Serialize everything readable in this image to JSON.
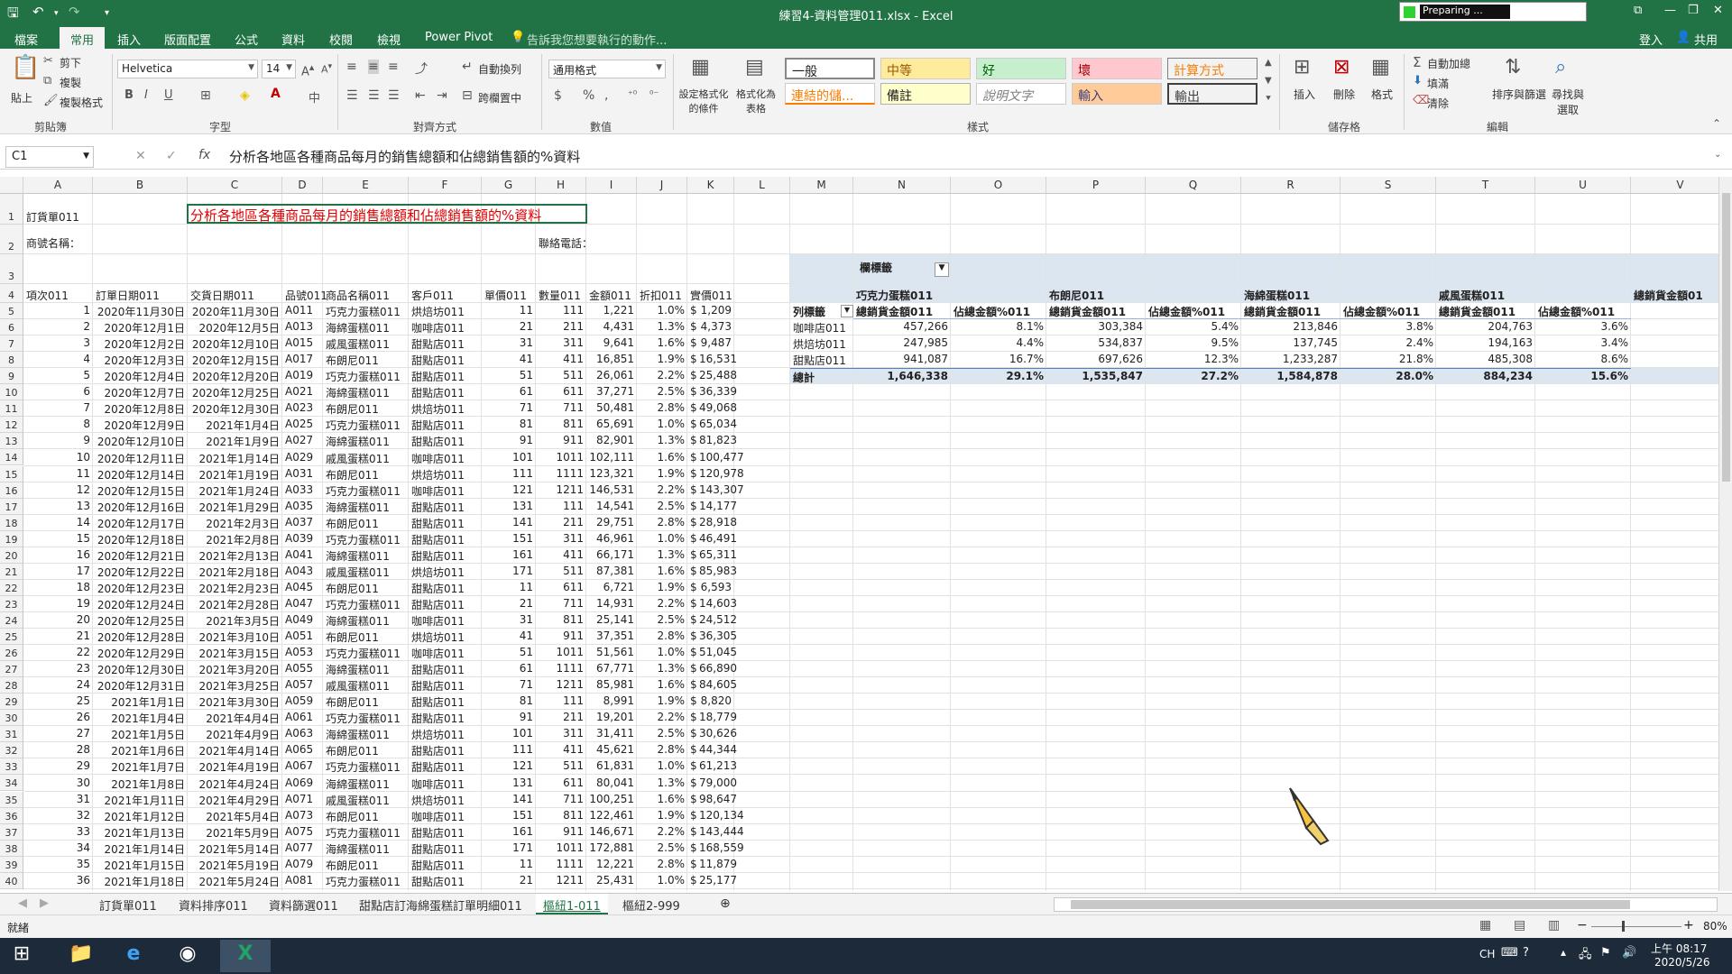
{
  "window": {
    "title": "練習4-資料管理011.xlsx - Excel",
    "preparing": "Preparing ..."
  },
  "ribbon_tabs": [
    "檔案",
    "常用",
    "插入",
    "版面配置",
    "公式",
    "資料",
    "校閱",
    "檢視",
    "Power Pivot"
  ],
  "tell_me": "告訴我您想要執行的動作...",
  "account": {
    "signin": "登入",
    "share": "共用"
  },
  "ribbon": {
    "paste": "貼上",
    "cut": "剪下",
    "copy": "複製",
    "format_painter": "複製格式",
    "clipboard_label": "剪貼簿",
    "font_name": "Helvetica",
    "font_size": "14",
    "font_label": "字型",
    "wrap_text": "自動換列",
    "merge_center": "跨欄置中",
    "align_label": "對齊方式",
    "number_format": "通用格式",
    "number_label": "數值",
    "cond_format": "設定格式化的條件",
    "format_table": "格式化為表格",
    "styles_label": "樣式",
    "styles": {
      "normal": "一般",
      "neutral": "中等",
      "good": "好",
      "bad": "壞",
      "calculation": "計算方式",
      "linked": "連結的儲...",
      "note": "備註",
      "explanatory": "說明文字",
      "input": "輸入",
      "output": "輸出"
    },
    "insert": "插入",
    "delete": "刪除",
    "format": "格式",
    "cells_label": "儲存格",
    "autosum": "自動加總",
    "fill": "填滿",
    "clear": "清除",
    "sort_filter": "排序與篩選",
    "find_select": "尋找與選取",
    "editing_label": "編輯"
  },
  "formula_bar": {
    "name_box": "C1",
    "formula": "分析各地區各種商品每月的銷售總額和佔總銷售額的%資料"
  },
  "columns": [
    "A",
    "B",
    "C",
    "D",
    "E",
    "F",
    "G",
    "H",
    "I",
    "J",
    "K",
    "L",
    "M",
    "N",
    "O",
    "P",
    "Q",
    "R",
    "S",
    "T",
    "U",
    "V"
  ],
  "sheet": {
    "a1": "訂貨單011",
    "c1": "分析各地區各種商品每月的銷售總額和佔總銷售額的%資料",
    "a2": "商號名稱：",
    "h2": "聯絡電話：",
    "headers": [
      "項次011",
      "訂單日期011",
      "交貨日期011",
      "品號011",
      "商品名稱011",
      "客戶011",
      "單價011",
      "數量011",
      "金額011",
      "折扣011",
      "實價011"
    ],
    "rows": [
      [
        "1",
        "2020年11月30日",
        "2020年11月30日",
        "A011",
        "巧克力蛋糕011",
        "烘焙坊011",
        "11",
        "111",
        "1,221",
        "1.0%",
        "$",
        "1,209"
      ],
      [
        "2",
        "2020年12月1日",
        "2020年12月5日",
        "A013",
        "海綿蛋糕011",
        "咖啡店011",
        "21",
        "211",
        "4,431",
        "1.3%",
        "$",
        "4,373"
      ],
      [
        "3",
        "2020年12月2日",
        "2020年12月10日",
        "A015",
        "戚風蛋糕011",
        "甜點店011",
        "31",
        "311",
        "9,641",
        "1.6%",
        "$",
        "9,487"
      ],
      [
        "4",
        "2020年12月3日",
        "2020年12月15日",
        "A017",
        "布朗尼011",
        "甜點店011",
        "41",
        "411",
        "16,851",
        "1.9%",
        "$",
        "16,531"
      ],
      [
        "5",
        "2020年12月4日",
        "2020年12月20日",
        "A019",
        "巧克力蛋糕011",
        "甜點店011",
        "51",
        "511",
        "26,061",
        "2.2%",
        "$",
        "25,488"
      ],
      [
        "6",
        "2020年12月7日",
        "2020年12月25日",
        "A021",
        "海綿蛋糕011",
        "甜點店011",
        "61",
        "611",
        "37,271",
        "2.5%",
        "$",
        "36,339"
      ],
      [
        "7",
        "2020年12月8日",
        "2020年12月30日",
        "A023",
        "布朗尼011",
        "烘焙坊011",
        "71",
        "711",
        "50,481",
        "2.8%",
        "$",
        "49,068"
      ],
      [
        "8",
        "2020年12月9日",
        "2021年1月4日",
        "A025",
        "巧克力蛋糕011",
        "甜點店011",
        "81",
        "811",
        "65,691",
        "1.0%",
        "$",
        "65,034"
      ],
      [
        "9",
        "2020年12月10日",
        "2021年1月9日",
        "A027",
        "海綿蛋糕011",
        "甜點店011",
        "91",
        "911",
        "82,901",
        "1.3%",
        "$",
        "81,823"
      ],
      [
        "10",
        "2020年12月11日",
        "2021年1月14日",
        "A029",
        "戚風蛋糕011",
        "咖啡店011",
        "101",
        "1011",
        "102,111",
        "1.6%",
        "$",
        "100,477"
      ],
      [
        "11",
        "2020年12月14日",
        "2021年1月19日",
        "A031",
        "布朗尼011",
        "烘焙坊011",
        "111",
        "1111",
        "123,321",
        "1.9%",
        "$",
        "120,978"
      ],
      [
        "12",
        "2020年12月15日",
        "2021年1月24日",
        "A033",
        "巧克力蛋糕011",
        "咖啡店011",
        "121",
        "1211",
        "146,531",
        "2.2%",
        "$",
        "143,307"
      ],
      [
        "13",
        "2020年12月16日",
        "2021年1月29日",
        "A035",
        "海綿蛋糕011",
        "甜點店011",
        "131",
        "111",
        "14,541",
        "2.5%",
        "$",
        "14,177"
      ],
      [
        "14",
        "2020年12月17日",
        "2021年2月3日",
        "A037",
        "布朗尼011",
        "甜點店011",
        "141",
        "211",
        "29,751",
        "2.8%",
        "$",
        "28,918"
      ],
      [
        "15",
        "2020年12月18日",
        "2021年2月8日",
        "A039",
        "巧克力蛋糕011",
        "甜點店011",
        "151",
        "311",
        "46,961",
        "1.0%",
        "$",
        "46,491"
      ],
      [
        "16",
        "2020年12月21日",
        "2021年2月13日",
        "A041",
        "海綿蛋糕011",
        "甜點店011",
        "161",
        "411",
        "66,171",
        "1.3%",
        "$",
        "65,311"
      ],
      [
        "17",
        "2020年12月22日",
        "2021年2月18日",
        "A043",
        "戚風蛋糕011",
        "烘焙坊011",
        "171",
        "511",
        "87,381",
        "1.6%",
        "$",
        "85,983"
      ],
      [
        "18",
        "2020年12月23日",
        "2021年2月23日",
        "A045",
        "布朗尼011",
        "甜點店011",
        "11",
        "611",
        "6,721",
        "1.9%",
        "$",
        "6,593"
      ],
      [
        "19",
        "2020年12月24日",
        "2021年2月28日",
        "A047",
        "巧克力蛋糕011",
        "甜點店011",
        "21",
        "711",
        "14,931",
        "2.2%",
        "$",
        "14,603"
      ],
      [
        "20",
        "2020年12月25日",
        "2021年3月5日",
        "A049",
        "海綿蛋糕011",
        "咖啡店011",
        "31",
        "811",
        "25,141",
        "2.5%",
        "$",
        "24,512"
      ],
      [
        "21",
        "2020年12月28日",
        "2021年3月10日",
        "A051",
        "布朗尼011",
        "烘焙坊011",
        "41",
        "911",
        "37,351",
        "2.8%",
        "$",
        "36,305"
      ],
      [
        "22",
        "2020年12月29日",
        "2021年3月15日",
        "A053",
        "巧克力蛋糕011",
        "咖啡店011",
        "51",
        "1011",
        "51,561",
        "1.0%",
        "$",
        "51,045"
      ],
      [
        "23",
        "2020年12月30日",
        "2021年3月20日",
        "A055",
        "海綿蛋糕011",
        "甜點店011",
        "61",
        "1111",
        "67,771",
        "1.3%",
        "$",
        "66,890"
      ],
      [
        "24",
        "2020年12月31日",
        "2021年3月25日",
        "A057",
        "戚風蛋糕011",
        "甜點店011",
        "71",
        "1211",
        "85,981",
        "1.6%",
        "$",
        "84,605"
      ],
      [
        "25",
        "2021年1月1日",
        "2021年3月30日",
        "A059",
        "布朗尼011",
        "甜點店011",
        "81",
        "111",
        "8,991",
        "1.9%",
        "$",
        "8,820"
      ],
      [
        "26",
        "2021年1月4日",
        "2021年4月4日",
        "A061",
        "巧克力蛋糕011",
        "甜點店011",
        "91",
        "211",
        "19,201",
        "2.2%",
        "$",
        "18,779"
      ],
      [
        "27",
        "2021年1月5日",
        "2021年4月9日",
        "A063",
        "海綿蛋糕011",
        "烘焙坊011",
        "101",
        "311",
        "31,411",
        "2.5%",
        "$",
        "30,626"
      ],
      [
        "28",
        "2021年1月6日",
        "2021年4月14日",
        "A065",
        "布朗尼011",
        "甜點店011",
        "111",
        "411",
        "45,621",
        "2.8%",
        "$",
        "44,344"
      ],
      [
        "29",
        "2021年1月7日",
        "2021年4月19日",
        "A067",
        "巧克力蛋糕011",
        "甜點店011",
        "121",
        "511",
        "61,831",
        "1.0%",
        "$",
        "61,213"
      ],
      [
        "30",
        "2021年1月8日",
        "2021年4月24日",
        "A069",
        "海綿蛋糕011",
        "咖啡店011",
        "131",
        "611",
        "80,041",
        "1.3%",
        "$",
        "79,000"
      ],
      [
        "31",
        "2021年1月11日",
        "2021年4月29日",
        "A071",
        "戚風蛋糕011",
        "烘焙坊011",
        "141",
        "711",
        "100,251",
        "1.6%",
        "$",
        "98,647"
      ],
      [
        "32",
        "2021年1月12日",
        "2021年5月4日",
        "A073",
        "布朗尼011",
        "咖啡店011",
        "151",
        "811",
        "122,461",
        "1.9%",
        "$",
        "120,134"
      ],
      [
        "33",
        "2021年1月13日",
        "2021年5月9日",
        "A075",
        "巧克力蛋糕011",
        "甜點店011",
        "161",
        "911",
        "146,671",
        "2.2%",
        "$",
        "143,444"
      ],
      [
        "34",
        "2021年1月14日",
        "2021年5月14日",
        "A077",
        "海綿蛋糕011",
        "甜點店011",
        "171",
        "1011",
        "172,881",
        "2.5%",
        "$",
        "168,559"
      ],
      [
        "35",
        "2021年1月15日",
        "2021年5月19日",
        "A079",
        "布朗尼011",
        "甜點店011",
        "11",
        "1111",
        "12,221",
        "2.8%",
        "$",
        "11,879"
      ],
      [
        "36",
        "2021年1月18日",
        "2021年5月24日",
        "A081",
        "巧克力蛋糕011",
        "甜點店011",
        "21",
        "1211",
        "25,431",
        "1.0%",
        "$",
        "25,177"
      ]
    ]
  },
  "pivot": {
    "col_labels": "欄標籤",
    "row_labels": "列標籤",
    "products": [
      "巧克力蛋糕011",
      "布朗尼011",
      "海綿蛋糕011",
      "戚風蛋糕011",
      "總銷貨金額01"
    ],
    "sub_headers": [
      "總銷貨金額011",
      "佔總金額%011"
    ],
    "rows": [
      {
        "label": "咖啡店011",
        "values": [
          "457,266",
          "8.1%",
          "303,384",
          "5.4%",
          "213,846",
          "3.8%",
          "204,763",
          "3.6%"
        ]
      },
      {
        "label": "烘焙坊011",
        "values": [
          "247,985",
          "4.4%",
          "534,837",
          "9.5%",
          "137,745",
          "2.4%",
          "194,163",
          "3.4%"
        ]
      },
      {
        "label": "甜點店011",
        "values": [
          "941,087",
          "16.7%",
          "697,626",
          "12.3%",
          "1,233,287",
          "21.8%",
          "485,308",
          "8.6%"
        ]
      }
    ],
    "total": {
      "label": "總計",
      "values": [
        "1,646,338",
        "29.1%",
        "1,535,847",
        "27.2%",
        "1,584,878",
        "28.0%",
        "884,234",
        "15.6%"
      ]
    }
  },
  "sheet_tabs": [
    "訂貨單011",
    "資料排序011",
    "資料篩選011",
    "甜點店訂海綿蛋糕訂單明細011",
    "樞紐1-011",
    "樞紐2-999"
  ],
  "active_sheet": "樞紐1-011",
  "status": {
    "ready": "就緒",
    "zoom": "80%"
  },
  "taskbar": {
    "lang": "CH",
    "time": "上午 08:17",
    "date": "2020/5/26"
  }
}
